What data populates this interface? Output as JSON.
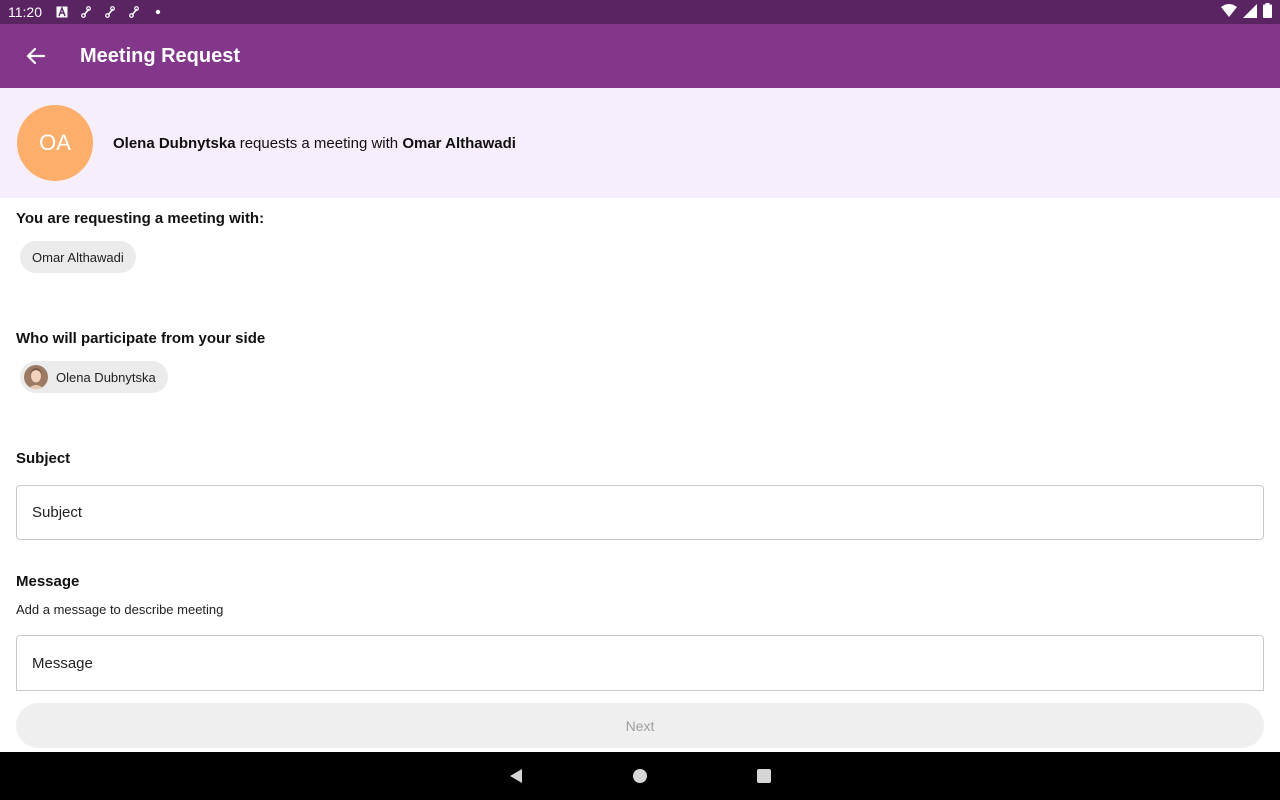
{
  "status_bar": {
    "time": "11:20",
    "left_icons": [
      "font-icon",
      "link-icon",
      "link-icon",
      "link-icon",
      "dot-icon"
    ],
    "right_icons": [
      "wifi-icon",
      "signal-icon",
      "battery-icon"
    ]
  },
  "app_bar": {
    "title": "Meeting Request",
    "back_icon": "arrow-left-icon"
  },
  "banner": {
    "avatar_initials": "OA",
    "avatar_color": "#fdae6b",
    "requester": "Olena Dubnytska",
    "middle_text": " requests a meeting with ",
    "target": "Omar Althawadi"
  },
  "requesting": {
    "label": "You are requesting a meeting with:",
    "chip": "Omar Althawadi"
  },
  "participants": {
    "label": "Who will participate from your side",
    "chip": "Olena Dubnytska"
  },
  "subject": {
    "label": "Subject",
    "placeholder": "Subject"
  },
  "message": {
    "label": "Message",
    "hint": "Add a message to describe meeting",
    "placeholder": "Message"
  },
  "next_button": {
    "label": "Next"
  },
  "colors": {
    "status_bar": "#5a2463",
    "app_bar": "#83378b",
    "banner_bg": "#f7eefc"
  },
  "nav_bar": {
    "icons": [
      "back-triangle-icon",
      "home-circle-icon",
      "recents-square-icon"
    ]
  }
}
